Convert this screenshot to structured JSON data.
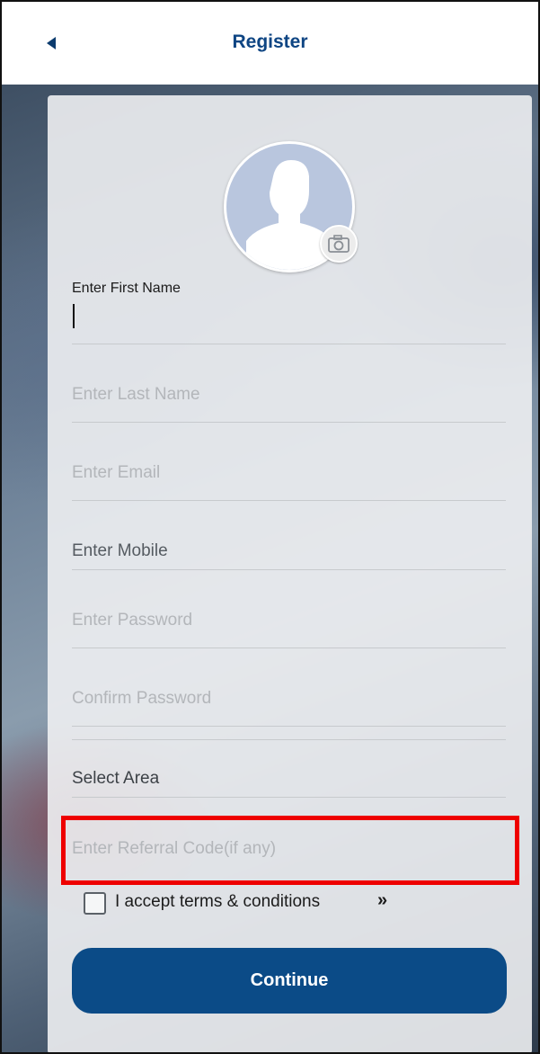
{
  "header": {
    "title": "Register"
  },
  "form": {
    "first_name_label": "Enter First Name",
    "last_name_placeholder": "Enter Last Name",
    "email_placeholder": "Enter Email",
    "mobile_placeholder": "Enter Mobile",
    "password_placeholder": "Enter Password",
    "confirm_password_placeholder": "Confirm Password",
    "area_select_label": "Select Area",
    "referral_placeholder": "Enter Referral Code(if any)",
    "terms_label": "I accept terms & conditions",
    "terms_link_glyph": "»",
    "continue_label": "Continue"
  },
  "colors": {
    "primary": "#0b4b87",
    "title": "#0e4583",
    "highlight": "#ee0000"
  },
  "icons": [
    "back-arrow-icon",
    "avatar-placeholder-icon",
    "camera-icon",
    "chevron-double-right-icon"
  ]
}
